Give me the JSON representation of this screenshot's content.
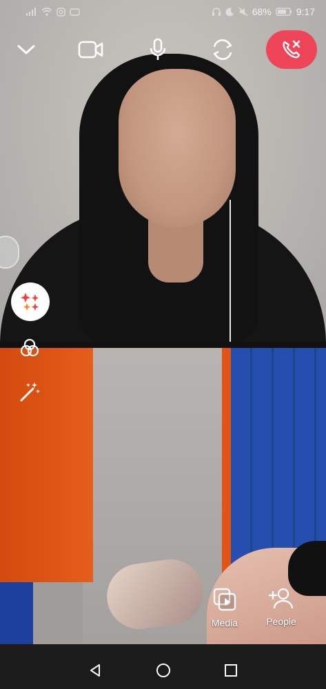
{
  "status_bar": {
    "battery": "68%",
    "time": "9:17",
    "icons_left": [
      "signal-icon",
      "wifi-icon",
      "instagram-icon",
      "camera-icon"
    ],
    "icons_right": [
      "headset-icon",
      "do-not-disturb-icon",
      "mute-icon",
      "battery-icon"
    ]
  },
  "call_controls": [
    {
      "name": "minimize",
      "icon": "chevron-down-icon"
    },
    {
      "name": "video",
      "icon": "video-camera-icon"
    },
    {
      "name": "microphone",
      "icon": "microphone-icon"
    },
    {
      "name": "switch-camera",
      "icon": "switch-camera-icon"
    },
    {
      "name": "end-call",
      "icon": "end-call-icon",
      "color": "#ef4559"
    }
  ],
  "left_tools": [
    {
      "name": "effects",
      "icon": "sparkles-icon"
    },
    {
      "name": "filters",
      "icon": "filters-icon"
    },
    {
      "name": "magic",
      "icon": "magic-wand-icon"
    }
  ],
  "actions": {
    "media_label": "Media",
    "people_label": "People"
  },
  "navigation": [
    "back-icon",
    "home-icon",
    "recents-icon"
  ]
}
